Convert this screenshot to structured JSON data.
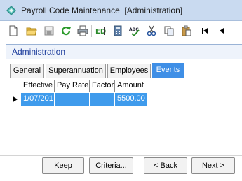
{
  "window": {
    "title": "Payroll Code Maintenance  [Administration]"
  },
  "toolbar": {
    "items": [
      {
        "name": "new-icon"
      },
      {
        "name": "open-folder-icon"
      },
      {
        "name": "save-icon"
      },
      {
        "name": "refresh-icon"
      },
      {
        "name": "print-icon"
      },
      {
        "name": "edit-icon"
      },
      {
        "name": "calculator-icon"
      },
      {
        "name": "spell-check-icon",
        "label": "ABC"
      },
      {
        "name": "cut-icon"
      },
      {
        "name": "copy-icon"
      },
      {
        "name": "paste-icon"
      },
      {
        "name": "first-record-icon"
      },
      {
        "name": "previous-record-icon"
      }
    ]
  },
  "module": {
    "title": "Administration"
  },
  "tabs": [
    {
      "label": "General",
      "active": false
    },
    {
      "label": "Superannuation",
      "active": false
    },
    {
      "label": "Employees",
      "active": false
    },
    {
      "label": "Events",
      "active": true
    }
  ],
  "grid": {
    "columns": [
      "Effective",
      "Pay Rate",
      "Factor",
      "Amount"
    ],
    "rows": [
      {
        "effective": "1/07/201",
        "pay_rate": "",
        "factor": "",
        "amount": "5500.00",
        "selected": true
      }
    ]
  },
  "buttons": {
    "keep": "Keep",
    "criteria": "Criteria...",
    "back": "< Back",
    "next": "Next >"
  },
  "colors": {
    "title_bar": "#c9daf0",
    "accent": "#3f8fe6",
    "selected_row": "#3f9bec",
    "module_title": "#1c3c9c"
  }
}
